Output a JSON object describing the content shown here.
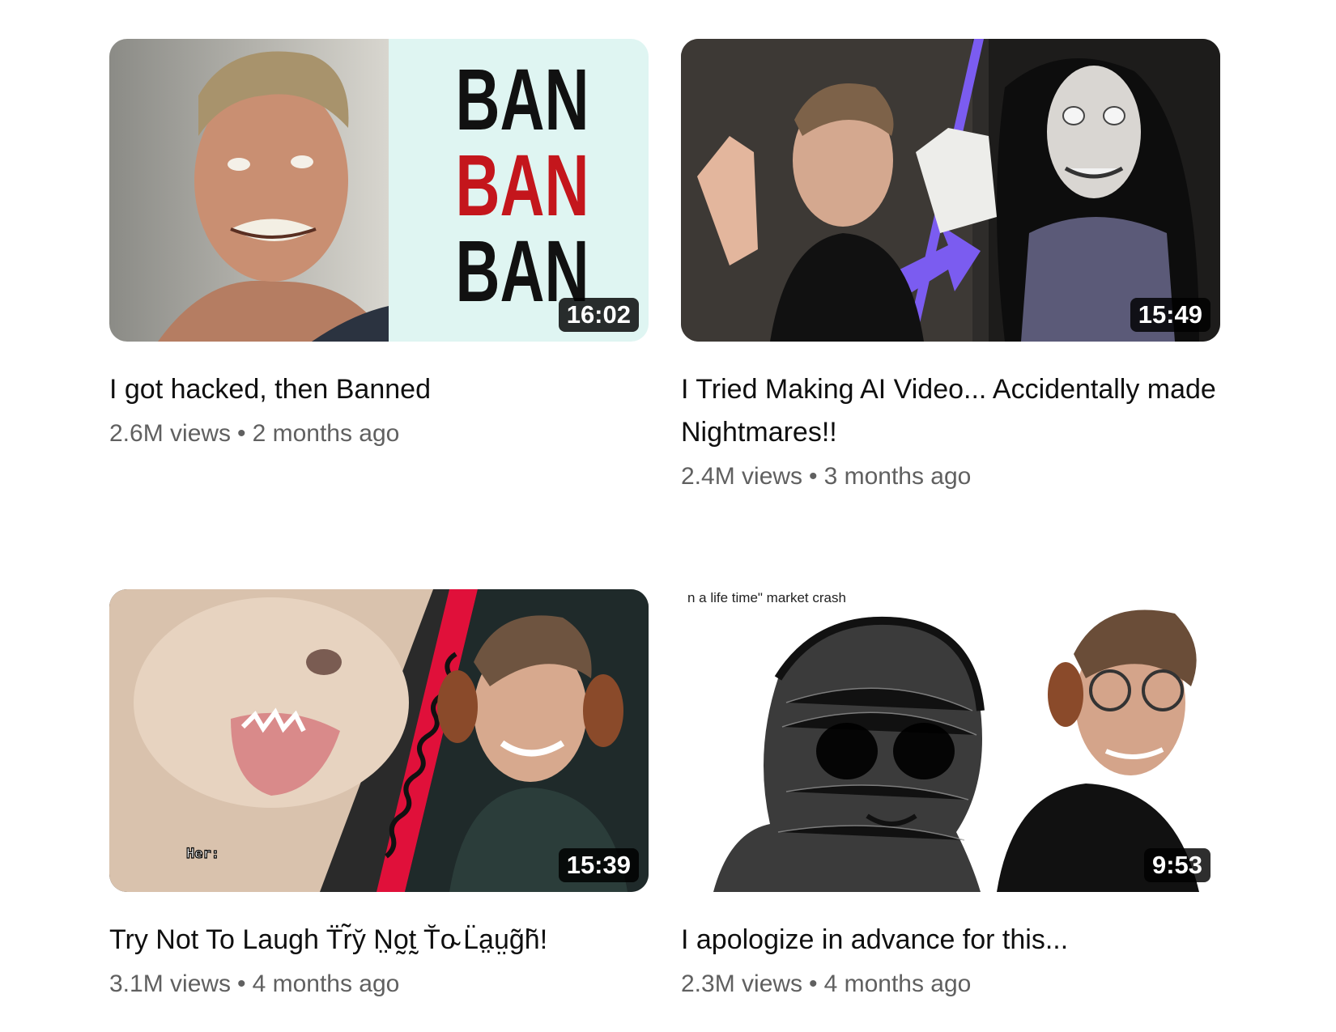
{
  "videos": [
    {
      "title": "I got hacked, then Banned",
      "duration": "16:02",
      "views": "2.6M views",
      "age": "2 months ago",
      "thumb_text": [
        "BAN",
        "BAN",
        "BAN"
      ],
      "thumb_text_colors": [
        "#111111",
        "#c4161c",
        "#111111"
      ]
    },
    {
      "title": "I Tried Making AI Video... Accidentally made Nightmares!!",
      "duration": "15:49",
      "views": "2.4M views",
      "age": "3 months ago"
    },
    {
      "title": "Try Not To Laugh T̈r̃y̆ N̤o̰t̰ T̆o̴ L̈a̤ṳg̃h̃!",
      "duration": "15:39",
      "views": "3.1M views",
      "age": "4 months ago",
      "thumb_text": "Her:"
    },
    {
      "title": "I apologize in advance for this...",
      "duration": "9:53",
      "views": "2.3M views",
      "age": "4 months ago",
      "thumb_text": "n a life time\" market crash"
    }
  ],
  "separator": "•",
  "colors": {
    "title": "#0f0f0f",
    "meta": "#606060",
    "badge_bg": "#000000",
    "accent_purple": "#7b5cf0",
    "accent_red": "#e0103a"
  }
}
